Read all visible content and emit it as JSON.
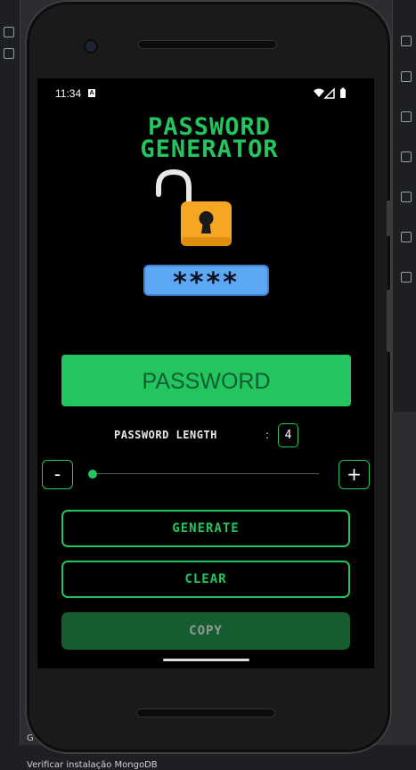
{
  "ide": {
    "bottom_text": "Verificar instalação MongoDB",
    "bottom_letter": "G"
  },
  "status_bar": {
    "time": "11:34",
    "notification_glyph": "A"
  },
  "app": {
    "title_line1": "PASSWORD",
    "title_line2": "GENERATOR",
    "masked_preview": "****",
    "password_display": "PASSWORD",
    "length_label": "PASSWORD LENGTH",
    "length_colon": ":",
    "length_value": "4",
    "decrement_label": "-",
    "increment_label": "+",
    "slider_level": 0,
    "generate_label": "GENERATE",
    "clear_label": "CLEAR",
    "copy_label": "COPY"
  },
  "colors": {
    "accent": "#22c55e",
    "copy_bg": "#165c30",
    "lock_body": "#f5a623",
    "stars_bg": "#5da8f4"
  }
}
